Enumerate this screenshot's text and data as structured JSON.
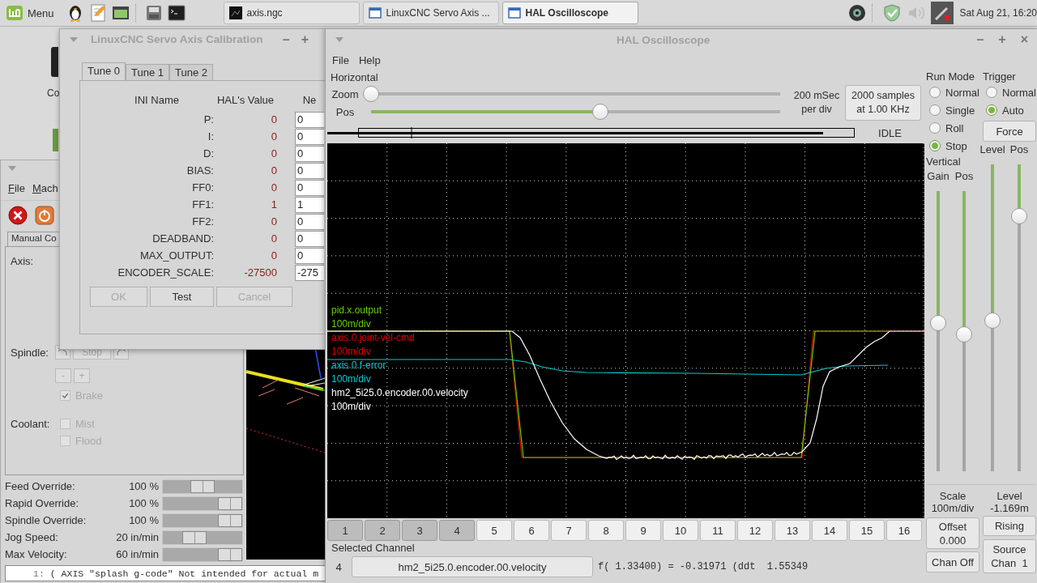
{
  "taskbar": {
    "menu_label": "Menu",
    "tasks": [
      {
        "label": "axis.ngc",
        "selected": false
      },
      {
        "label": "LinuxCNC Servo Axis ...",
        "selected": false
      },
      {
        "label": "HAL Oscilloscope",
        "selected": true
      }
    ],
    "clock": "Sat Aug 21, 16:20"
  },
  "desktop": {
    "icon_label": "Co"
  },
  "axis_window": {
    "menu": [
      "File",
      "Mach"
    ],
    "tab": "Manual Co",
    "axis_label": "Axis:",
    "spindle": {
      "label": "Spindle:",
      "stop": "Stop",
      "minus": "-",
      "plus": "+",
      "disabled": true
    },
    "brake": {
      "label": "Brake",
      "checked": true,
      "disabled": true
    },
    "coolant": {
      "label": "Coolant:",
      "options": [
        {
          "label": "Mist",
          "checked": false,
          "disabled": true
        },
        {
          "label": "Flood",
          "checked": false,
          "disabled": true
        }
      ]
    },
    "overrides": [
      {
        "label": "Feed Override:",
        "value": "100 %",
        "level": 0.5
      },
      {
        "label": "Rapid Override:",
        "value": "100 %",
        "level": 1
      },
      {
        "label": "Spindle Override:",
        "value": "100 %",
        "level": 1
      },
      {
        "label": "Jog Speed:",
        "value": "20 in/min",
        "level": 0.36
      },
      {
        "label": "Max Velocity:",
        "value": "60 in/min",
        "level": 1
      }
    ],
    "code": [
      {
        "number": "1:",
        "text": "( AXIS \"splash g-code\" Not intended for actual m"
      }
    ]
  },
  "calibration_window": {
    "title": "LinuxCNC Servo Axis Calibration",
    "controls": [
      "–",
      "+"
    ],
    "tabs": [
      {
        "label": "Tune 0",
        "selected": true
      },
      {
        "label": "Tune 1",
        "selected": false
      },
      {
        "label": "Tune 2",
        "selected": false
      }
    ],
    "columns": [
      "INI Name",
      "HAL's Value",
      "Ne"
    ],
    "rows": [
      {
        "name": "P:",
        "hal": "0",
        "new": "0"
      },
      {
        "name": "I:",
        "hal": "0",
        "new": "0"
      },
      {
        "name": "D:",
        "hal": "0",
        "new": "0"
      },
      {
        "name": "BIAS:",
        "hal": "0",
        "new": "0"
      },
      {
        "name": "FF0:",
        "hal": "0",
        "new": "0"
      },
      {
        "name": "FF1:",
        "hal": "1",
        "new": "1"
      },
      {
        "name": "FF2:",
        "hal": "0",
        "new": "0"
      },
      {
        "name": "DEADBAND:",
        "hal": "0",
        "new": "0"
      },
      {
        "name": "MAX_OUTPUT:",
        "hal": "0",
        "new": "0"
      },
      {
        "name": "ENCODER_SCALE:",
        "hal": "-27500",
        "new": "-275"
      }
    ],
    "buttons": [
      {
        "label": "OK",
        "disabled": true
      },
      {
        "label": "Test",
        "disabled": false
      },
      {
        "label": "Cancel",
        "disabled": true
      }
    ]
  },
  "scope_window": {
    "title": "HAL Oscilloscope",
    "controls": [
      "–",
      "+",
      "×"
    ],
    "menu": [
      "File",
      "Help"
    ],
    "horizontal": {
      "label": "Horizontal",
      "zoom": {
        "label": "Zoom",
        "level": 0
      },
      "pos": {
        "label": "Pos",
        "level": 0.56
      },
      "rate": "200 mSec\nper div",
      "samples": "2000 samples\nat 1.00 KHz",
      "status": "IDLE"
    },
    "channels": [
      {
        "name": "pid.x.output",
        "scale": "100m/div",
        "color": "#66cc00"
      },
      {
        "name": "axis.0.joint-vel-cmd",
        "scale": "100m/div",
        "color": "#e00000"
      },
      {
        "name": "axis.0.f-error",
        "scale": "100m/div",
        "color": "#00cccc"
      },
      {
        "name": "hm2_5i25.0.encoder.00.velocity",
        "scale": "100m/div",
        "color": "#ffffff"
      }
    ],
    "channel_buttons": [
      {
        "label": "1",
        "on": true
      },
      {
        "label": "2",
        "on": true
      },
      {
        "label": "3",
        "on": true
      },
      {
        "label": "4",
        "on": true
      },
      {
        "label": "5",
        "on": false
      },
      {
        "label": "6",
        "on": false
      },
      {
        "label": "7",
        "on": false
      },
      {
        "label": "8",
        "on": false
      },
      {
        "label": "9",
        "on": false
      },
      {
        "label": "10",
        "on": false
      },
      {
        "label": "11",
        "on": false
      },
      {
        "label": "12",
        "on": false
      },
      {
        "label": "13",
        "on": false
      },
      {
        "label": "14",
        "on": false
      },
      {
        "label": "15",
        "on": false
      },
      {
        "label": "16",
        "on": false
      }
    ],
    "selected_channel": {
      "label": "Selected Channel",
      "number": "4",
      "name": "hm2_5i25.0.encoder.00.velocity",
      "readout": "f( 1.33400) = -0.31971 (ddt  1.55349"
    },
    "run_mode": {
      "label": "Run Mode",
      "options": [
        {
          "label": "Normal",
          "selected": false
        },
        {
          "label": "Single",
          "selected": false
        },
        {
          "label": "Roll",
          "selected": false
        },
        {
          "label": "Stop",
          "selected": true
        }
      ]
    },
    "trigger": {
      "label": "Trigger",
      "options": [
        {
          "label": "Normal",
          "selected": false
        },
        {
          "label": "Auto",
          "selected": true
        }
      ],
      "force": "Force"
    },
    "vertical": {
      "label": "Vertical",
      "gain": {
        "label": "Gain",
        "level": 0.47
      },
      "pos": {
        "label": "Pos",
        "level": 0.51
      },
      "scale_label": "Scale",
      "scale": "100m/div",
      "offset": "Offset\n0.000",
      "chan_off": "Chan Off"
    },
    "trigger_controls": {
      "level": {
        "label": "Level",
        "level": 0.51
      },
      "pos": {
        "label": "Pos",
        "level": 0.17
      },
      "level_label": "Level",
      "level_value": "-1.169m",
      "edge": "Rising",
      "source": "Source\nChan  1"
    }
  }
}
